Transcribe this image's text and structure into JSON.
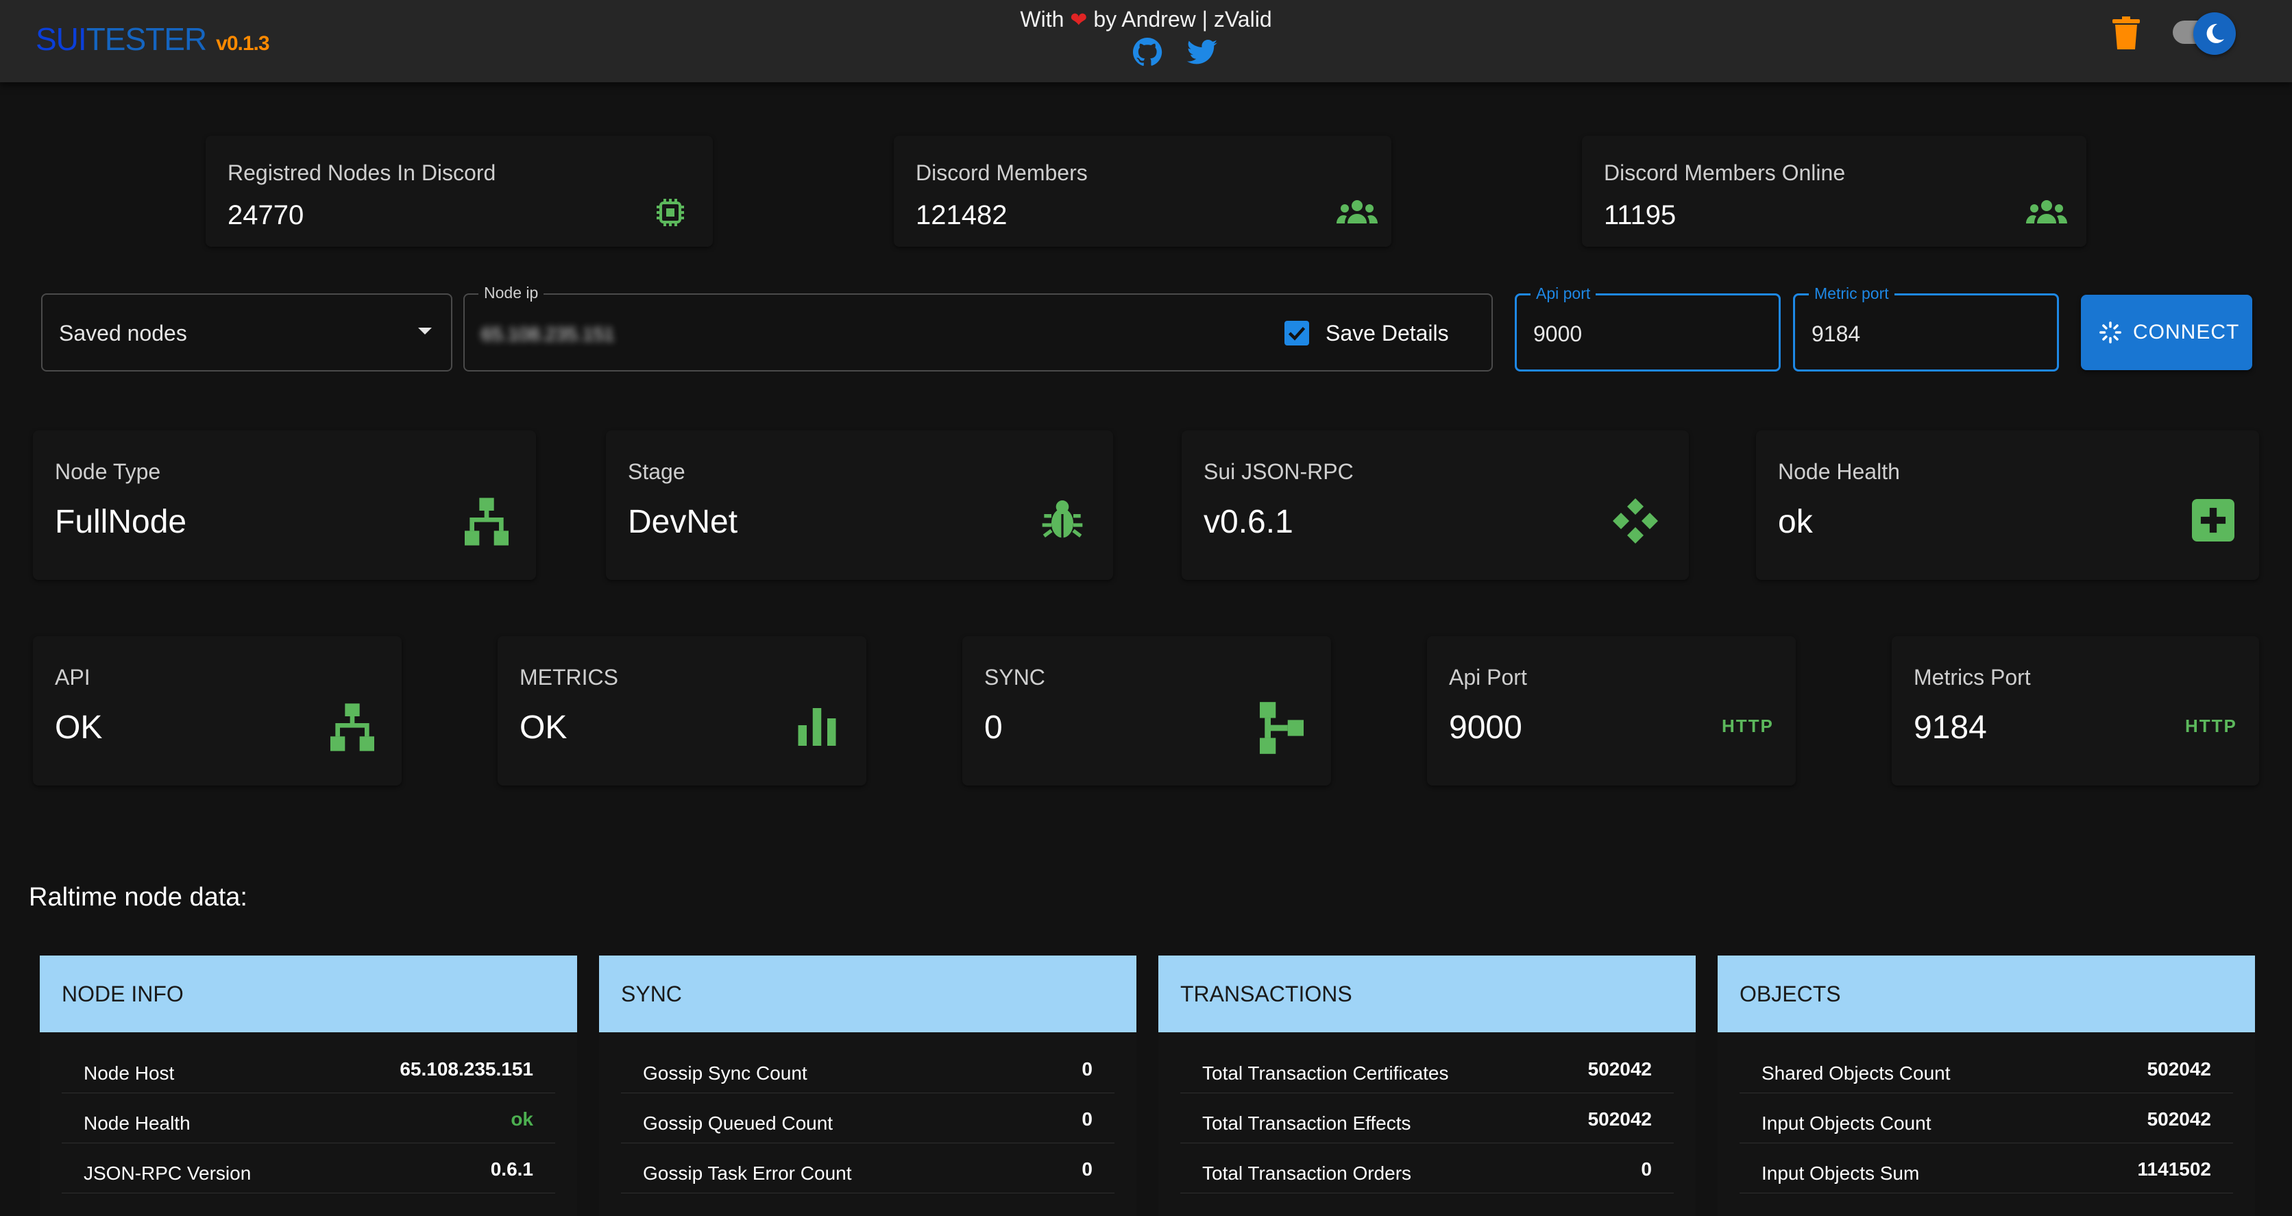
{
  "header": {
    "logo_sui": "SUI",
    "logo_tester": "TESTER",
    "version": "v0.1.3",
    "credit_prefix": "With",
    "heart": "❤",
    "credit_suffix": "by Andrew | zValid",
    "github_icon": "github-icon",
    "twitter_icon": "twitter-icon",
    "trash_icon": "trash-icon",
    "theme_toggle": "dark-mode-toggle"
  },
  "discord_stats": [
    {
      "label": "Registred Nodes In Discord",
      "value": "24770",
      "icon": "chip-icon"
    },
    {
      "label": "Discord Members",
      "value": "121482",
      "icon": "users-icon"
    },
    {
      "label": "Discord Members Online",
      "value": "11195",
      "icon": "users-icon"
    }
  ],
  "form": {
    "saved_nodes": "Saved nodes",
    "node_ip_label": "Node ip",
    "node_ip_value": "65.108.235.151",
    "save_details": "Save Details",
    "save_details_checked": true,
    "api_port_label": "Api port",
    "api_port_value": "9000",
    "metric_port_label": "Metric port",
    "metric_port_value": "9184",
    "connect_label": "CONNECT"
  },
  "node_cards": [
    {
      "label": "Node Type",
      "value": "FullNode",
      "icon": "sitemap-icon"
    },
    {
      "label": "Stage",
      "value": "DevNet",
      "icon": "bug-icon"
    },
    {
      "label": "Sui JSON-RPC",
      "value": "v0.6.1",
      "icon": "diamond-arrows-icon"
    },
    {
      "label": "Node Health",
      "value": "ok",
      "icon": "plus-square-icon"
    }
  ],
  "status_cards": [
    {
      "label": "API",
      "value": "OK",
      "icon": "sitemap-icon"
    },
    {
      "label": "METRICS",
      "value": "OK",
      "icon": "bar-chart-icon"
    },
    {
      "label": "SYNC",
      "value": "0",
      "icon": "sync-tree-icon"
    },
    {
      "label": "Api Port",
      "value": "9000",
      "icon_text": "HTTP"
    },
    {
      "label": "Metrics Port",
      "value": "9184",
      "icon_text": "HTTP"
    }
  ],
  "section_title": "Raltime node data:",
  "panels": [
    {
      "title": "NODE INFO",
      "rows": [
        {
          "k": "Node Host",
          "v": "65.108.235.151"
        },
        {
          "k": "Node Health",
          "v": "ok"
        },
        {
          "k": "JSON-RPC Version",
          "v": "0.6.1"
        }
      ]
    },
    {
      "title": "SYNC",
      "rows": [
        {
          "k": "Gossip Sync Count",
          "v": "0"
        },
        {
          "k": "Gossip Queued Count",
          "v": "0"
        },
        {
          "k": "Gossip Task Error Count",
          "v": "0"
        }
      ]
    },
    {
      "title": "TRANSACTIONS",
      "rows": [
        {
          "k": "Total Transaction Certificates",
          "v": "502042"
        },
        {
          "k": "Total Transaction Effects",
          "v": "502042"
        },
        {
          "k": "Total Transaction Orders",
          "v": "0"
        }
      ]
    },
    {
      "title": "OBJECTS",
      "rows": [
        {
          "k": "Shared Objects Count",
          "v": "502042"
        },
        {
          "k": "Input Objects Count",
          "v": "502042"
        },
        {
          "k": "Input Objects Sum",
          "v": "1141502"
        }
      ]
    }
  ],
  "colors": {
    "accent": "#1e88e5",
    "icon_green": "#5cb85c",
    "ok_green": "#4caf50",
    "panel_header": "#9fd4f7",
    "version_orange": "#ff8a00"
  }
}
